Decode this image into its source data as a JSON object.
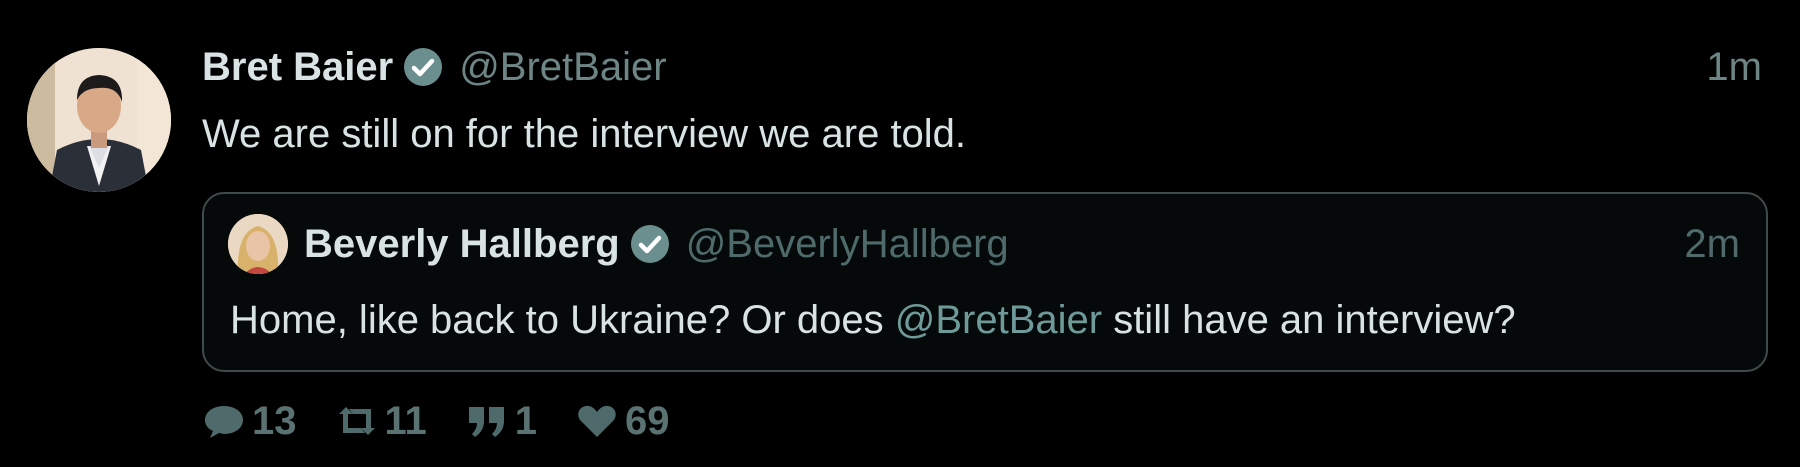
{
  "tweet": {
    "author_name": "Bret Baier",
    "author_handle": "@BretBaier",
    "time": "1m",
    "text": "We are still on for the interview we are told."
  },
  "quoted": {
    "author_name": "Beverly Hallberg",
    "author_handle": "@BeverlyHallberg",
    "time": "2m",
    "text_before": "Home, like back to Ukraine? Or does ",
    "mention": "@BretBaier",
    "text_after": " still have an interview?"
  },
  "actions": {
    "replies": "13",
    "retweets": "11",
    "quotes": "1",
    "likes": "69"
  },
  "colors": {
    "background": "#000000",
    "verified_badge": "#6b8f8f",
    "mention": "#6f9a9a",
    "icon": "#4f6a6a"
  },
  "icons": [
    "verified-badge-icon",
    "reply-icon",
    "retweet-icon",
    "quote-icon",
    "heart-icon"
  ]
}
